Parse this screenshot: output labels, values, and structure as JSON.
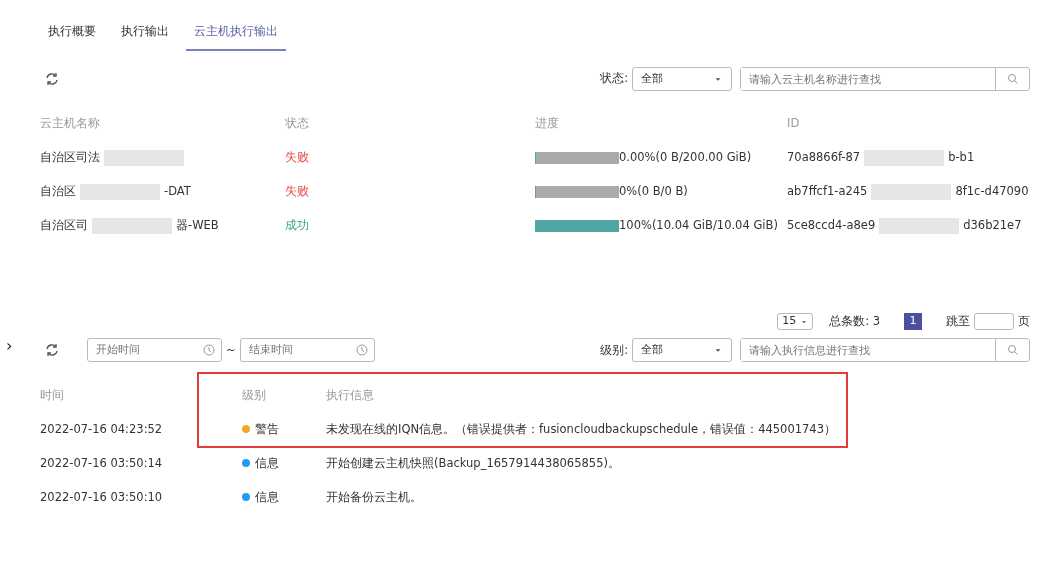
{
  "tabs": [
    {
      "label": "执行概要",
      "selected": false
    },
    {
      "label": "执行输出",
      "selected": false
    },
    {
      "label": "云主机执行输出",
      "selected": true
    }
  ],
  "vm_filter": {
    "label": "状态:",
    "value": "全部",
    "placeholder": "请输入云主机名称进行查找"
  },
  "vm_table": {
    "columns": [
      "云主机名称",
      "状态",
      "进度",
      "ID"
    ],
    "rows": [
      {
        "name": "自治区司法",
        "name_tail": "",
        "status": "失败",
        "failed": true,
        "level": 0,
        "progress": "0.00%(0 B/200.00 GiB)",
        "id": "70a8866f-87",
        "id_tail": "b-b1"
      },
      {
        "name": "自治区",
        "name_tail": "-DAT",
        "status": "失败",
        "failed": true,
        "level": 0,
        "progress": "0%(0 B/0 B)",
        "id": "ab7ffcf1-a245",
        "id_tail": "8f1c-d47090"
      },
      {
        "name": "自治区司",
        "name_tail": "器-WEB",
        "status": "成功",
        "failed": false,
        "level": 1,
        "progress": "100%(10.04 GiB/10.04 GiB)",
        "id": "5ce8ccd4-a8e9",
        "id_tail": "d36b21e7"
      }
    ]
  },
  "pagination": {
    "page_size": "15",
    "total": "总条数: 3",
    "pages": [
      {
        "label": "1",
        "selected": true
      }
    ],
    "jump_label": "跳至",
    "page_unit": "页"
  },
  "expand_toggle": "›",
  "log_filter": {
    "start_placeholder": "开始时间",
    "separator": "~",
    "end_placeholder": "结束时间",
    "label": "级别:",
    "value": "全部",
    "placeholder": "请输入执行信息进行查找"
  },
  "log_table": {
    "columns": [
      "时间",
      "级别",
      "执行信息"
    ],
    "rows": [
      {
        "time": "2022-07-16 04:23:52",
        "level_label": "警告",
        "color": "#f5a623",
        "message": "未发现在线的IQN信息。（错误提供者：fusioncloudbackupschedule，错误值：445001743）",
        "highlighted": true
      },
      {
        "time": "2022-07-16 03:50:14",
        "level_label": "信息",
        "color": "#1e9ef0",
        "message": "开始创建云主机快照(Backup_1657914438065855)。",
        "highlighted": false
      },
      {
        "time": "2022-07-16 03:50:10",
        "level_label": "信息",
        "color": "#1e9ef0",
        "message": "开始备份云主机。",
        "highlighted": false
      }
    ]
  }
}
